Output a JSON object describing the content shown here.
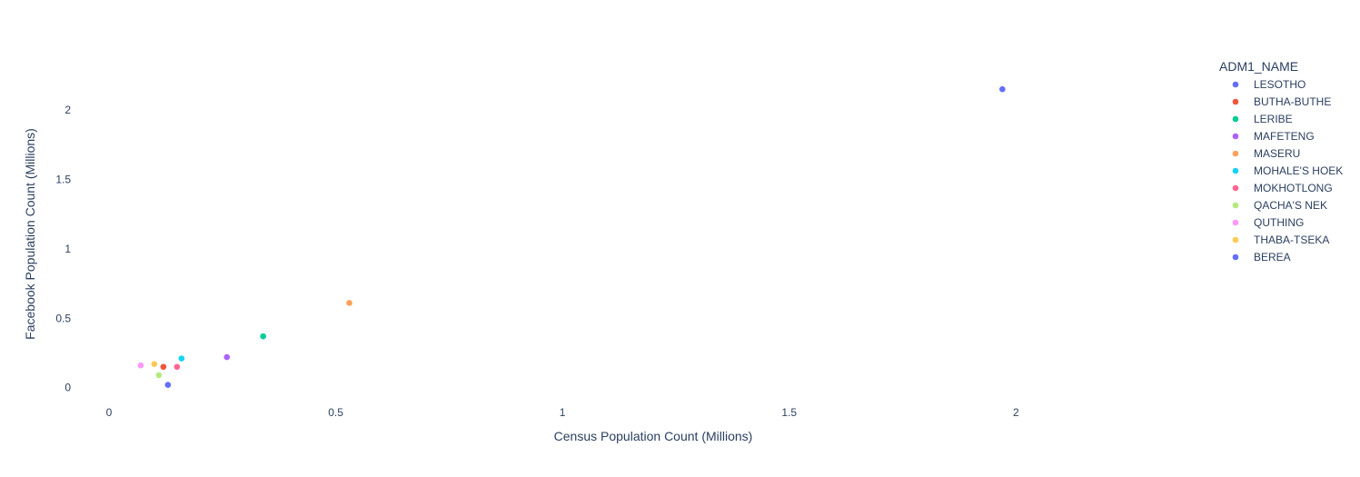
{
  "chart_data": {
    "type": "scatter",
    "title": "",
    "xlabel": "Census Population Count (Millions)",
    "ylabel": "Facebook Population Count (Millions)",
    "xlim": [
      -0.08,
      2.4
    ],
    "ylim": [
      -0.12,
      2.4
    ],
    "x_ticks": [
      0,
      0.5,
      1,
      1.5,
      2
    ],
    "x_tick_labels": [
      "0",
      "0.5",
      "1",
      "1.5",
      "2"
    ],
    "y_ticks": [
      0,
      0.5,
      1,
      1.5,
      2
    ],
    "y_tick_labels": [
      "0",
      "0.5",
      "1",
      "1.5",
      "2"
    ],
    "grid": false,
    "legend_title": "ADM1_NAME",
    "legend_position": "top-right",
    "series": [
      {
        "name": "LESOTHO",
        "color": "#636efa",
        "points": [
          {
            "x": 1.97,
            "y": 2.15
          }
        ]
      },
      {
        "name": "BUTHA-BUTHE",
        "color": "#ef553b",
        "points": [
          {
            "x": 0.12,
            "y": 0.15
          }
        ]
      },
      {
        "name": "LERIBE",
        "color": "#00cc96",
        "points": [
          {
            "x": 0.34,
            "y": 0.37
          }
        ]
      },
      {
        "name": "MAFETENG",
        "color": "#ab63fa",
        "points": [
          {
            "x": 0.26,
            "y": 0.22
          }
        ]
      },
      {
        "name": "MASERU",
        "color": "#ffa15a",
        "points": [
          {
            "x": 0.53,
            "y": 0.61
          }
        ]
      },
      {
        "name": "MOHALE'S HOEK",
        "color": "#19d3f3",
        "points": [
          {
            "x": 0.16,
            "y": 0.21
          }
        ]
      },
      {
        "name": "MOKHOTLONG",
        "color": "#ff6692",
        "points": [
          {
            "x": 0.15,
            "y": 0.15
          }
        ]
      },
      {
        "name": "QACHA'S NEK",
        "color": "#b6e880",
        "points": [
          {
            "x": 0.11,
            "y": 0.09
          }
        ]
      },
      {
        "name": "QUTHING",
        "color": "#ff97ff",
        "points": [
          {
            "x": 0.07,
            "y": 0.16
          }
        ]
      },
      {
        "name": "THABA-TSEKA",
        "color": "#fecb52",
        "points": [
          {
            "x": 0.1,
            "y": 0.17
          }
        ]
      },
      {
        "name": "BEREA",
        "color": "#636efa",
        "points": [
          {
            "x": 0.13,
            "y": 0.02
          }
        ]
      }
    ]
  }
}
